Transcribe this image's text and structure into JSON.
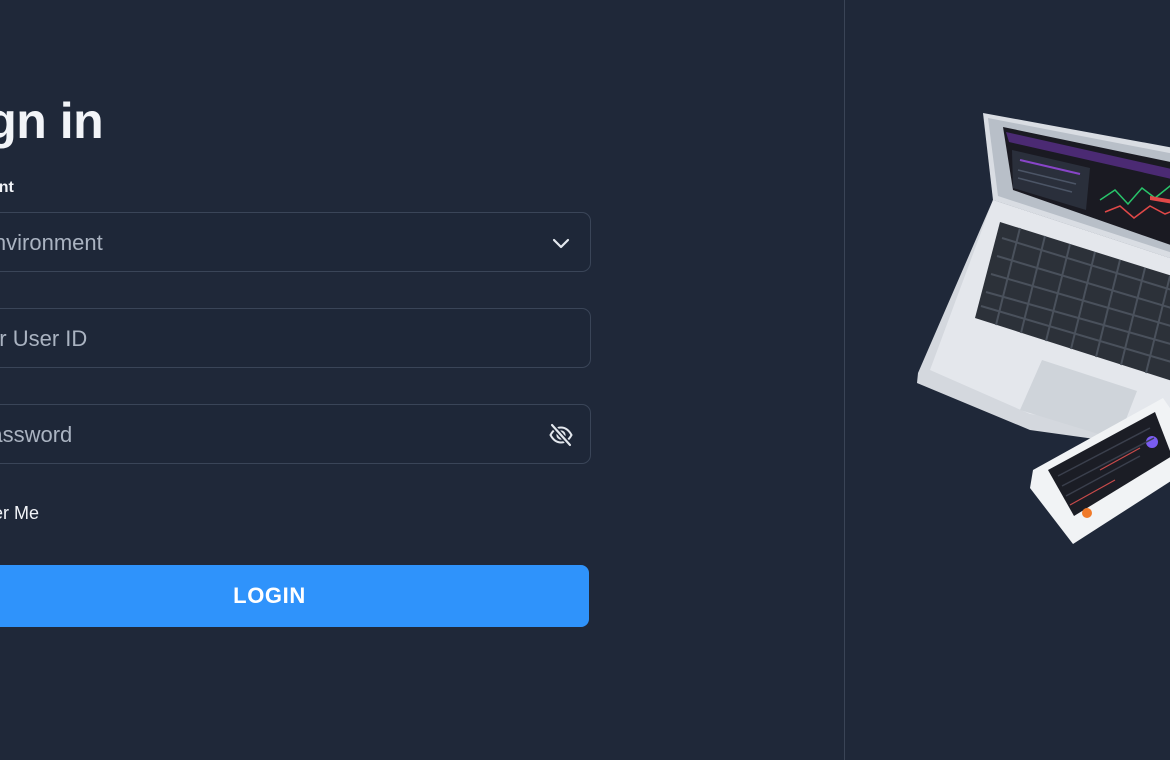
{
  "login_form": {
    "title": "Sign in",
    "environment_label": "Environment",
    "environment_value": "Select Environment",
    "user_id_placeholder": "Enter User ID",
    "password_placeholder": "Enter Password",
    "remember_label": "Remember Me",
    "login_label": "LOGIN"
  },
  "icons": {
    "environment_dropdown": "chevron-down-icon",
    "password_toggle": "eye-off-icon"
  },
  "colors": {
    "background": "#1f2839",
    "field_border": "#3a4558",
    "primary_button": "#2f93fb",
    "text_primary": "#f2f4f8",
    "text_placeholder": "#aab3c1"
  }
}
